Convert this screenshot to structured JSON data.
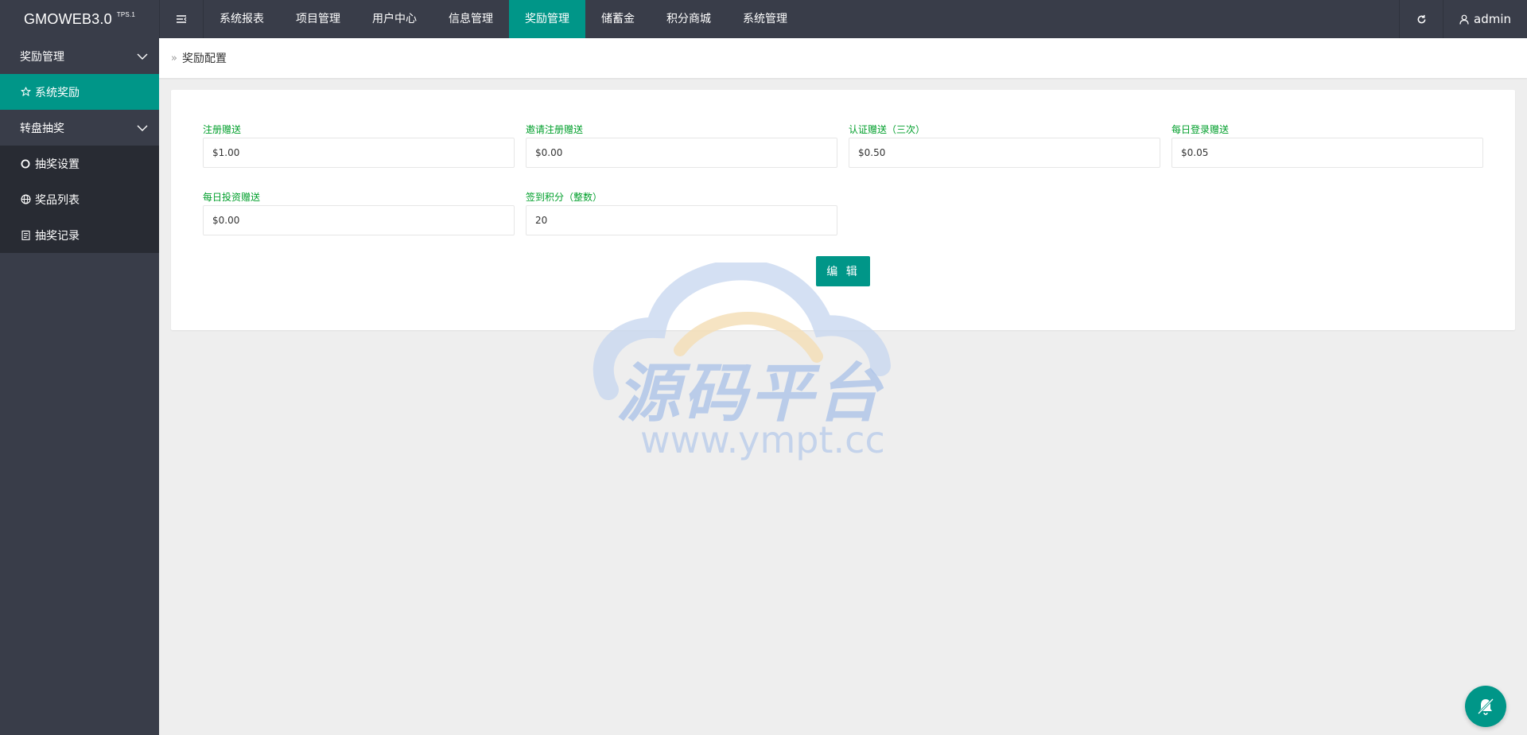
{
  "app": {
    "logo_text": "GMOWEB3.0",
    "logo_version": "TPS.1"
  },
  "topnav": {
    "items": [
      {
        "label": "系统报表"
      },
      {
        "label": "项目管理"
      },
      {
        "label": "用户中心"
      },
      {
        "label": "信息管理"
      },
      {
        "label": "奖励管理",
        "active": true
      },
      {
        "label": "储蓄金"
      },
      {
        "label": "积分商城"
      },
      {
        "label": "系统管理"
      }
    ],
    "user_label": "admin"
  },
  "sidebar": {
    "groups": [
      {
        "label": "奖励管理",
        "children": [
          {
            "label": "系统奖励",
            "icon": "star-icon",
            "active": true
          }
        ]
      },
      {
        "label": "转盘抽奖",
        "children": [
          {
            "label": "抽奖设置",
            "icon": "circle-icon"
          },
          {
            "label": "奖品列表",
            "icon": "globe-icon"
          },
          {
            "label": "抽奖记录",
            "icon": "clipboard-icon"
          }
        ]
      }
    ]
  },
  "breadcrumb": {
    "separator": "»",
    "current": "奖励配置"
  },
  "form": {
    "fields": [
      {
        "label": "注册赠送",
        "value": "$1.00"
      },
      {
        "label": "邀请注册赠送",
        "value": "$0.00"
      },
      {
        "label": "认证赠送（三次）",
        "value": "$0.50"
      },
      {
        "label": "每日登录赠送",
        "value": "$0.05"
      },
      {
        "label": "每日投资赠送",
        "value": "$0.00"
      },
      {
        "label": "签到积分（整数）",
        "value": "20"
      }
    ],
    "submit_label": "编 辑"
  },
  "watermark": {
    "title": "源码平台",
    "url": "www.ympt.cc"
  },
  "colors": {
    "accent": "#009688",
    "topbar": "#393d49",
    "label_green": "#009f2b"
  }
}
